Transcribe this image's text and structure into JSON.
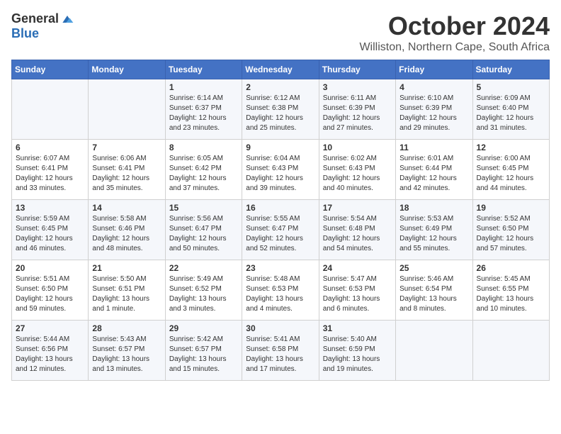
{
  "logo": {
    "general": "General",
    "blue": "Blue"
  },
  "title": "October 2024",
  "subtitle": "Williston, Northern Cape, South Africa",
  "days_of_week": [
    "Sunday",
    "Monday",
    "Tuesday",
    "Wednesday",
    "Thursday",
    "Friday",
    "Saturday"
  ],
  "weeks": [
    [
      {
        "day": "",
        "info": ""
      },
      {
        "day": "",
        "info": ""
      },
      {
        "day": "1",
        "sunrise": "6:14 AM",
        "sunset": "6:37 PM",
        "daylight": "12 hours and 23 minutes."
      },
      {
        "day": "2",
        "sunrise": "6:12 AM",
        "sunset": "6:38 PM",
        "daylight": "12 hours and 25 minutes."
      },
      {
        "day": "3",
        "sunrise": "6:11 AM",
        "sunset": "6:39 PM",
        "daylight": "12 hours and 27 minutes."
      },
      {
        "day": "4",
        "sunrise": "6:10 AM",
        "sunset": "6:39 PM",
        "daylight": "12 hours and 29 minutes."
      },
      {
        "day": "5",
        "sunrise": "6:09 AM",
        "sunset": "6:40 PM",
        "daylight": "12 hours and 31 minutes."
      }
    ],
    [
      {
        "day": "6",
        "sunrise": "6:07 AM",
        "sunset": "6:41 PM",
        "daylight": "12 hours and 33 minutes."
      },
      {
        "day": "7",
        "sunrise": "6:06 AM",
        "sunset": "6:41 PM",
        "daylight": "12 hours and 35 minutes."
      },
      {
        "day": "8",
        "sunrise": "6:05 AM",
        "sunset": "6:42 PM",
        "daylight": "12 hours and 37 minutes."
      },
      {
        "day": "9",
        "sunrise": "6:04 AM",
        "sunset": "6:43 PM",
        "daylight": "12 hours and 39 minutes."
      },
      {
        "day": "10",
        "sunrise": "6:02 AM",
        "sunset": "6:43 PM",
        "daylight": "12 hours and 40 minutes."
      },
      {
        "day": "11",
        "sunrise": "6:01 AM",
        "sunset": "6:44 PM",
        "daylight": "12 hours and 42 minutes."
      },
      {
        "day": "12",
        "sunrise": "6:00 AM",
        "sunset": "6:45 PM",
        "daylight": "12 hours and 44 minutes."
      }
    ],
    [
      {
        "day": "13",
        "sunrise": "5:59 AM",
        "sunset": "6:45 PM",
        "daylight": "12 hours and 46 minutes."
      },
      {
        "day": "14",
        "sunrise": "5:58 AM",
        "sunset": "6:46 PM",
        "daylight": "12 hours and 48 minutes."
      },
      {
        "day": "15",
        "sunrise": "5:56 AM",
        "sunset": "6:47 PM",
        "daylight": "12 hours and 50 minutes."
      },
      {
        "day": "16",
        "sunrise": "5:55 AM",
        "sunset": "6:47 PM",
        "daylight": "12 hours and 52 minutes."
      },
      {
        "day": "17",
        "sunrise": "5:54 AM",
        "sunset": "6:48 PM",
        "daylight": "12 hours and 54 minutes."
      },
      {
        "day": "18",
        "sunrise": "5:53 AM",
        "sunset": "6:49 PM",
        "daylight": "12 hours and 55 minutes."
      },
      {
        "day": "19",
        "sunrise": "5:52 AM",
        "sunset": "6:50 PM",
        "daylight": "12 hours and 57 minutes."
      }
    ],
    [
      {
        "day": "20",
        "sunrise": "5:51 AM",
        "sunset": "6:50 PM",
        "daylight": "12 hours and 59 minutes."
      },
      {
        "day": "21",
        "sunrise": "5:50 AM",
        "sunset": "6:51 PM",
        "daylight": "13 hours and 1 minute."
      },
      {
        "day": "22",
        "sunrise": "5:49 AM",
        "sunset": "6:52 PM",
        "daylight": "13 hours and 3 minutes."
      },
      {
        "day": "23",
        "sunrise": "5:48 AM",
        "sunset": "6:53 PM",
        "daylight": "13 hours and 4 minutes."
      },
      {
        "day": "24",
        "sunrise": "5:47 AM",
        "sunset": "6:53 PM",
        "daylight": "13 hours and 6 minutes."
      },
      {
        "day": "25",
        "sunrise": "5:46 AM",
        "sunset": "6:54 PM",
        "daylight": "13 hours and 8 minutes."
      },
      {
        "day": "26",
        "sunrise": "5:45 AM",
        "sunset": "6:55 PM",
        "daylight": "13 hours and 10 minutes."
      }
    ],
    [
      {
        "day": "27",
        "sunrise": "5:44 AM",
        "sunset": "6:56 PM",
        "daylight": "13 hours and 12 minutes."
      },
      {
        "day": "28",
        "sunrise": "5:43 AM",
        "sunset": "6:57 PM",
        "daylight": "13 hours and 13 minutes."
      },
      {
        "day": "29",
        "sunrise": "5:42 AM",
        "sunset": "6:57 PM",
        "daylight": "13 hours and 15 minutes."
      },
      {
        "day": "30",
        "sunrise": "5:41 AM",
        "sunset": "6:58 PM",
        "daylight": "13 hours and 17 minutes."
      },
      {
        "day": "31",
        "sunrise": "5:40 AM",
        "sunset": "6:59 PM",
        "daylight": "13 hours and 19 minutes."
      },
      {
        "day": "",
        "info": ""
      },
      {
        "day": "",
        "info": ""
      }
    ]
  ]
}
